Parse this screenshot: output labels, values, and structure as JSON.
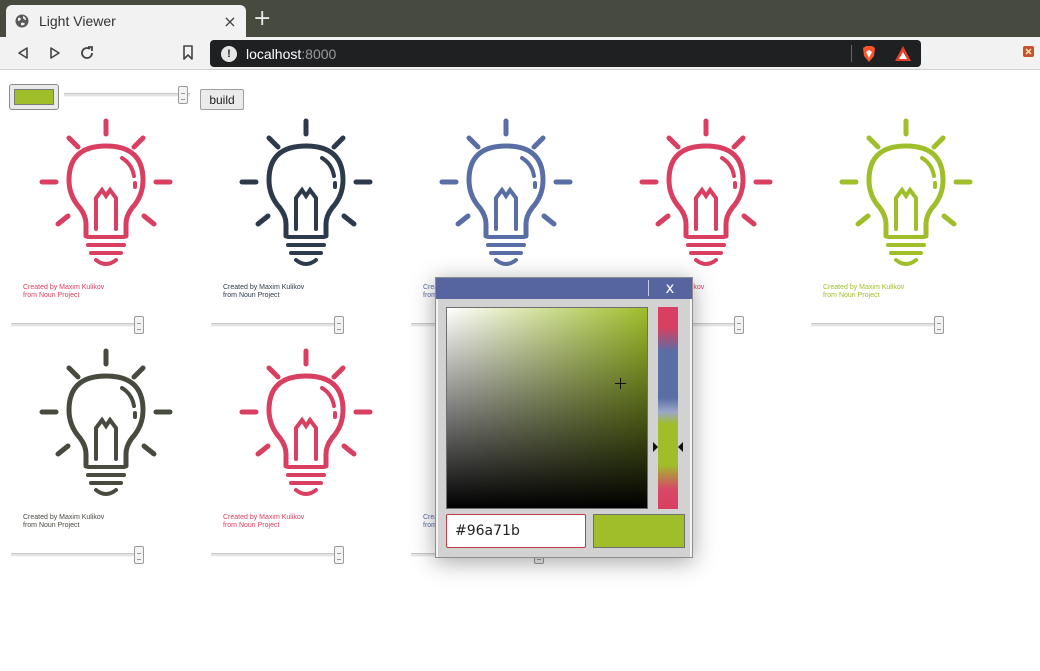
{
  "browser": {
    "tab_title": "Light Viewer",
    "tab_close": "×",
    "new_tab": "+",
    "url_host": "localhost",
    "url_port": ":8000",
    "url_info": "!"
  },
  "controls": {
    "swatch_color": "#9fbe2a",
    "build_label": "build",
    "size_slider_level": 0.95
  },
  "bulbs": [
    {
      "color": "#d93f60",
      "credit_line1": "Created by Maxim Kulikov",
      "credit_line2": "from Noun Project",
      "slider_level": 0.98
    },
    {
      "color": "#2c3a4b",
      "credit_line1": "Created by Maxim Kulikov",
      "credit_line2": "from Noun Project",
      "slider_level": 0.98
    },
    {
      "color": "#5a6ea6",
      "credit_line1": "Created by Maxim Kulikov",
      "credit_line2": "from Noun Project",
      "slider_level": 0.98
    },
    {
      "color": "#d93f60",
      "credit_line1": "Created by Maxim Kulikov",
      "credit_line2": "from Noun Project",
      "slider_level": 0.98
    },
    {
      "color": "#9fbe2a",
      "credit_line1": "Created by Maxim Kulikov",
      "credit_line2": "from Noun Project",
      "slider_level": 0.98
    },
    {
      "color": "#474b3f",
      "credit_line1": "Created by Maxim Kulikov",
      "credit_line2": "from Noun Project",
      "slider_level": 0.98
    },
    {
      "color": "#d93f60",
      "credit_line1": "Created by Maxim Kulikov",
      "credit_line2": "from Noun Project",
      "slider_level": 0.98
    },
    {
      "color": "#5a6ea6",
      "credit_line1": "Created by Maxim Kulikov",
      "credit_line2": "from Noun Project",
      "slider_level": 0.98
    }
  ],
  "picker": {
    "close_label": "x",
    "hex_value": "#96a71b",
    "preview_color": "#9fbe2a"
  }
}
